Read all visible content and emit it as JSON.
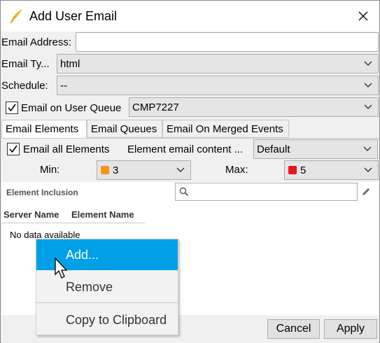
{
  "window": {
    "title": "Add User Email"
  },
  "icons": {
    "app": "feather-icon",
    "close": "close-icon",
    "search": "search-icon",
    "edit": "pencil-icon",
    "chevron": "chevron-down-icon"
  },
  "form": {
    "email_address_label": "Email Address:",
    "email_address_value": "",
    "email_type_label": "Email Ty...",
    "email_type_value": "html",
    "schedule_label": "Schedule:",
    "schedule_value": "--",
    "email_on_queue_label": "Email on User Queue",
    "email_on_queue_checked": true,
    "queue_value": "CMP7227"
  },
  "tabs": [
    "Email Elements",
    "Email Queues",
    "Email On Merged Events"
  ],
  "active_tab": 0,
  "elements": {
    "email_all_label": "Email all Elements",
    "email_all_checked": true,
    "content_label": "Element email content ...",
    "content_value": "Default",
    "min_label": "Min:",
    "min_value": "3",
    "min_color": "#f7941d",
    "max_label": "Max:",
    "max_value": "5",
    "max_color": "#e8141b"
  },
  "inclusion": {
    "title": "Element Inclusion",
    "search_value": "",
    "columns": [
      "Server Name",
      "Element Name"
    ],
    "empty_text": "No data available"
  },
  "context_menu": {
    "items": [
      "Add...",
      "Remove",
      "Copy to Clipboard"
    ],
    "highlighted": 0
  },
  "buttons": {
    "cancel": "Cancel",
    "apply": "Apply"
  },
  "colors": {
    "accent": "#00a0e6"
  }
}
